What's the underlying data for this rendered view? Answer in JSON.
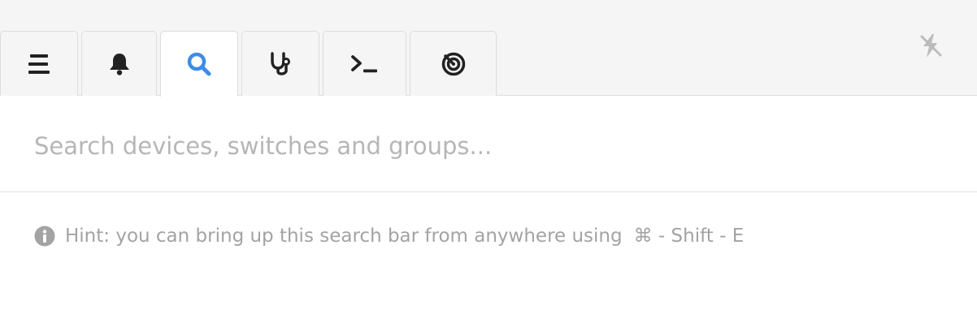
{
  "tabs": [
    {
      "id": "menu",
      "icon": "menu-icon",
      "active": false
    },
    {
      "id": "notifications",
      "icon": "bell-icon",
      "active": false
    },
    {
      "id": "search",
      "icon": "search-icon",
      "active": true
    },
    {
      "id": "diagnostics",
      "icon": "stethoscope-icon",
      "active": false
    },
    {
      "id": "console",
      "icon": "terminal-icon",
      "active": false
    },
    {
      "id": "radar",
      "icon": "radar-icon",
      "active": false
    }
  ],
  "status": {
    "icon": "offline-bolt-icon"
  },
  "search": {
    "placeholder": "Search devices, switches and groups...",
    "value": ""
  },
  "hint": {
    "icon": "info-icon",
    "text": "Hint: you can bring up this search bar from anywhere using",
    "shortcut": "⌘ - Shift - E"
  },
  "colors": {
    "accent": "#3d8de6",
    "icon_dark": "#222222",
    "muted": "#a3a3a3",
    "status_icon": "#bcbcbc"
  }
}
